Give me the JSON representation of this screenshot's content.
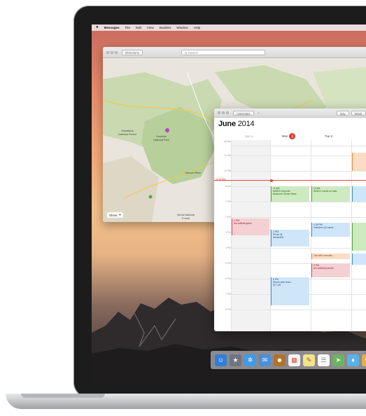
{
  "menubar": {
    "apple": "",
    "app_name": "Messages",
    "items": [
      "File",
      "Edit",
      "View",
      "Buddies",
      "Window",
      "Help"
    ]
  },
  "maps": {
    "directions_label": "Directions",
    "search_placeholder": "Q Search",
    "show_label": "Show",
    "labels": [
      {
        "text": "Stanislaus\nNational Forest"
      },
      {
        "text": "Yosemite\nNational Park"
      },
      {
        "text": "Merced River"
      },
      {
        "text": "Sierra National\nForest"
      },
      {
        "text": "Mariposa"
      }
    ]
  },
  "calendar": {
    "calendars_label": "Calendars",
    "view_day": "Day",
    "view_week": "Week",
    "month": "June",
    "year": "2014",
    "days": [
      {
        "label": "Sun 1"
      },
      {
        "label": "Mon",
        "badge": "2"
      },
      {
        "label": "Tue 3"
      }
    ],
    "times": [
      "all-day",
      "11 AM",
      "12 PM",
      "Noon",
      "1 PM",
      "2 PM",
      "3 PM",
      "4 PM",
      "5 PM",
      "6 PM",
      "7 PM",
      "8 PM"
    ],
    "now_label": "11:30 AM",
    "events": [
      {
        "day": "Mon",
        "text": "11 AM\nWWDC Keynote\nMoscone Center West",
        "color": "green"
      },
      {
        "day": "Tue 3",
        "text": "11 AM\nWWDC hands on labs",
        "color": "green"
      },
      {
        "day": "Sun 1",
        "text": "1 PM\nMo softball game",
        "color": "red"
      },
      {
        "day": "Mon",
        "text": "2 PM\nPicnic @\nwindsurfer",
        "color": "blue"
      },
      {
        "day": "Tue 3",
        "text": "1:30 PM\nInterview Q4 candi...",
        "color": "blue"
      },
      {
        "day": "Tue 3",
        "text": "Call with consulta...",
        "color": "orange"
      },
      {
        "day": "Tue 3",
        "text": "5 PM\nMo softball practice",
        "color": "red"
      },
      {
        "day": "Mon",
        "text": "6 PM\nDinner with team\nSF Loft",
        "color": "blue"
      }
    ]
  },
  "dock": {
    "icons": [
      "finder-icon",
      "launchpad-icon",
      "safari-icon",
      "mail-icon",
      "contacts-icon",
      "calendar-icon",
      "notes-icon",
      "reminders-icon",
      "maps-icon",
      "messages-icon",
      "photos-icon",
      "itunes-icon"
    ]
  }
}
